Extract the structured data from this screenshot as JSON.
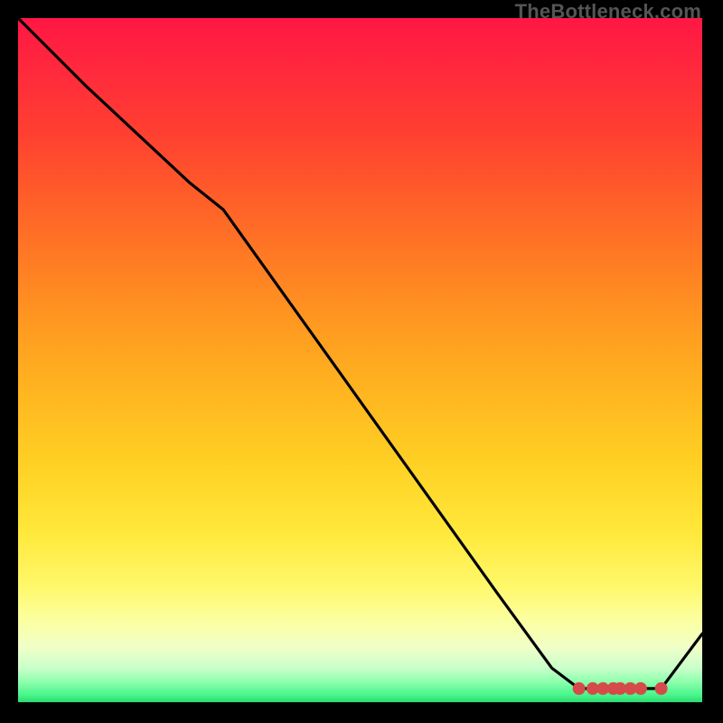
{
  "watermark": "TheBottleneck.com",
  "colors": {
    "line": "#000000",
    "marker_stroke": "#d64a4a",
    "marker_fill": "#d64a4a"
  },
  "chart_data": {
    "type": "line",
    "title": "",
    "xlabel": "",
    "ylabel": "",
    "xlim": [
      0,
      100
    ],
    "ylim": [
      0,
      100
    ],
    "x": [
      0,
      10,
      25,
      30,
      40,
      50,
      60,
      70,
      78,
      82,
      86,
      90,
      94,
      100
    ],
    "y": [
      100,
      90,
      76,
      72,
      58,
      44,
      30,
      16,
      5,
      2,
      2,
      2,
      2,
      10
    ],
    "markers_x": [
      82,
      84,
      85.5,
      87,
      88,
      89.5,
      91,
      94
    ],
    "markers_y": [
      2,
      2,
      2,
      2,
      2,
      2,
      2,
      2
    ]
  }
}
